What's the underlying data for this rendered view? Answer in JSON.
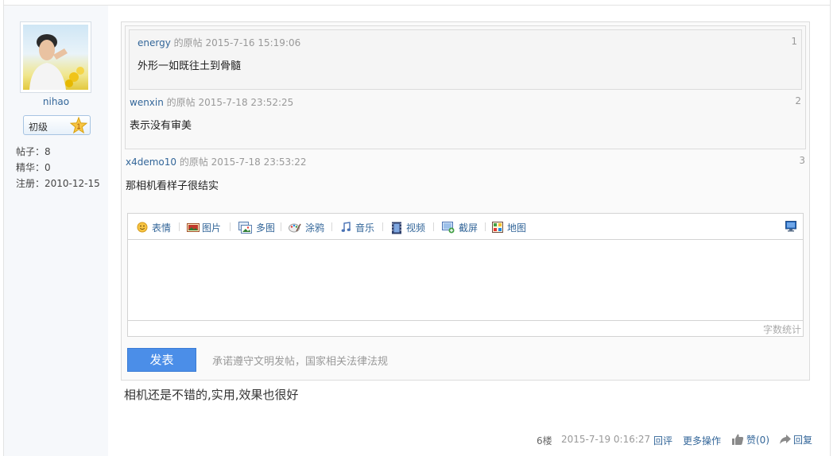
{
  "user": {
    "name": "nihao",
    "level": "初级",
    "level_badge": "1",
    "posts_label": "帖子：8",
    "digest_label": "精华：0",
    "register_label": "注册：2010-12-15"
  },
  "quotes": [
    {
      "user": "energy",
      "suffix": " 的原帖 2015-7-16 15:19:06",
      "num": "1",
      "body": "外形一如既往土到骨髓"
    },
    {
      "user": "wenxin",
      "suffix": " 的原帖 2015-7-18 23:52:25",
      "num": "2",
      "body": "表示没有审美"
    },
    {
      "user": "x4demo10",
      "suffix": " 的原帖 2015-7-18 23:53:22",
      "num": "3",
      "body": "那相机看样子很结实"
    }
  ],
  "editor": {
    "toolbar": [
      {
        "label": "表情",
        "icon": "smiley-icon"
      },
      {
        "label": "图片",
        "icon": "image-icon"
      },
      {
        "label": "多图",
        "icon": "multi-image-icon"
      },
      {
        "label": "涂鸦",
        "icon": "graffiti-icon"
      },
      {
        "label": "音乐",
        "icon": "music-icon"
      },
      {
        "label": "视频",
        "icon": "video-icon"
      },
      {
        "label": "截屏",
        "icon": "screenshot-icon"
      },
      {
        "label": "地图",
        "icon": "map-icon"
      }
    ],
    "word_count_label": "字数统计",
    "submit_label": "发表",
    "notice": "承诺遵守文明发帖，国家相关法律法规"
  },
  "post": {
    "body": "相机还是不错的,实用,效果也很好",
    "floor": "6楼",
    "time": "2015-7-19 0:16:27",
    "reply_comment": "回评",
    "more_actions": "更多操作",
    "like": "赞(0)",
    "reply": "回复"
  },
  "colors": {
    "link": "#336699",
    "submit": "#4b8ee8",
    "sidebar_bg": "#f6f8fb"
  }
}
